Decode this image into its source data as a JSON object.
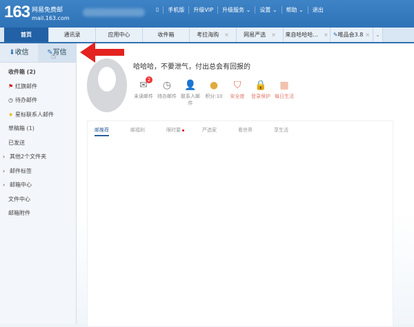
{
  "header": {
    "logo_num": "163",
    "logo_text": "网易免费邮",
    "logo_domain": "mail.163.com",
    "nav": [
      "▯",
      "手机版",
      "升级VIP",
      "升级服务 ⌄",
      "设置 ⌄",
      "帮助 ⌄",
      "退出"
    ]
  },
  "tabs": [
    {
      "label": "首页"
    },
    {
      "label": "通讯录"
    },
    {
      "label": "应用中心"
    },
    {
      "label": "收件箱"
    },
    {
      "label": "考拉海购",
      "close": "×"
    },
    {
      "label": "网易严选",
      "close": "×"
    },
    {
      "label": "来自哈哈哈...",
      "close": "×"
    },
    {
      "label": "唯品会3.8",
      "close": "×"
    }
  ],
  "tabs_more": "⌄",
  "toolbar": {
    "receive": "收信",
    "compose": "写信"
  },
  "sidebar": [
    "收件箱 (2)",
    "红旗邮件",
    "待办邮件",
    "星标联系人邮件",
    "草稿箱 (1)",
    "已发送",
    "其他2个文件夹",
    "邮件标签",
    "邮箱中心",
    "文件中心",
    "邮箱附件"
  ],
  "main": {
    "motto": "哈哈哈，不要泄气，付出总会有回报的",
    "stats": [
      {
        "label": "未读邮件",
        "badge": "2"
      },
      {
        "label": "待办邮件"
      },
      {
        "label": "联系人邮件"
      },
      {
        "label": "积分:10"
      },
      {
        "label": "安全度"
      },
      {
        "label": "登录保护"
      },
      {
        "label": "每日生活"
      }
    ],
    "panel_tabs": [
      "邮推荐",
      "邮福利",
      "限时要",
      "严选家",
      "看世界",
      "享生活"
    ]
  },
  "colors": {
    "header": "#2f73b7",
    "arrow": "#e3231f"
  }
}
